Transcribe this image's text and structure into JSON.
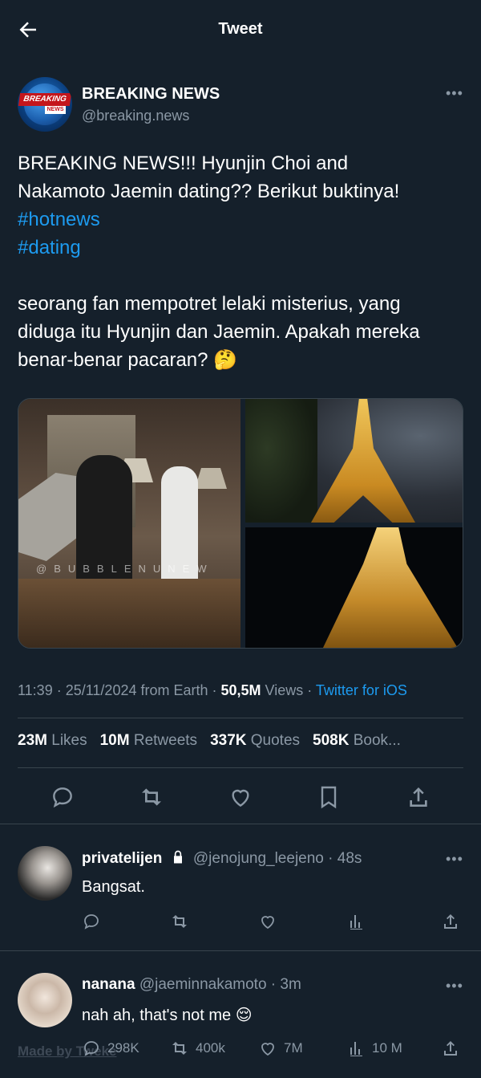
{
  "header": {
    "title": "Tweet"
  },
  "author": {
    "name": "BREAKING NEWS",
    "handle": "@breaking.news",
    "avatar_text_top": "BREAKING",
    "avatar_text_bottom": "NEWS"
  },
  "tweet": {
    "line1": "BREAKING NEWS!!! Hyunjin Choi and",
    "line2": "Nakamoto Jaemin dating?? Berikut buktinya!",
    "hashtag1": "#hotnews",
    "hashtag2": "#dating",
    "line3": "seorang fan mempotret lelaki misterius, yang",
    "line4": "diduga itu Hyunjin dan Jaemin. Apakah mereka",
    "line5": "benar-benar pacaran? 🤔"
  },
  "media": {
    "watermark": "@BUBBLENUNEW"
  },
  "meta": {
    "time": "11:39",
    "date": "25/11/2024 from Earth",
    "views_count": "50,5M",
    "views_label": "Views",
    "client": "Twitter for iOS"
  },
  "stats": [
    {
      "count": "23M",
      "label": "Likes"
    },
    {
      "count": "10M",
      "label": "Retweets"
    },
    {
      "count": "337K",
      "label": "Quotes"
    },
    {
      "count": "508K",
      "label": "Book..."
    }
  ],
  "replies": [
    {
      "name": "privatelijen",
      "handle": "@jenojung_leejeno · 48s",
      "text": "Bangsat.",
      "reply_count": "",
      "retweet_count": "",
      "like_count": "",
      "view_count": ""
    },
    {
      "name": "nanana",
      "handle": "@jaeminnakamoto · 3m",
      "text": "nah ah, that's not me 😌",
      "reply_count": "298K",
      "retweet_count": "400k",
      "like_count": "7M",
      "view_count": "10 M"
    }
  ],
  "footer": {
    "made_by": "Made by Tweke"
  },
  "colors": {
    "background": "#15202b",
    "accent": "#1d9bf0",
    "muted": "#8b98a5",
    "divider": "#38444d"
  }
}
